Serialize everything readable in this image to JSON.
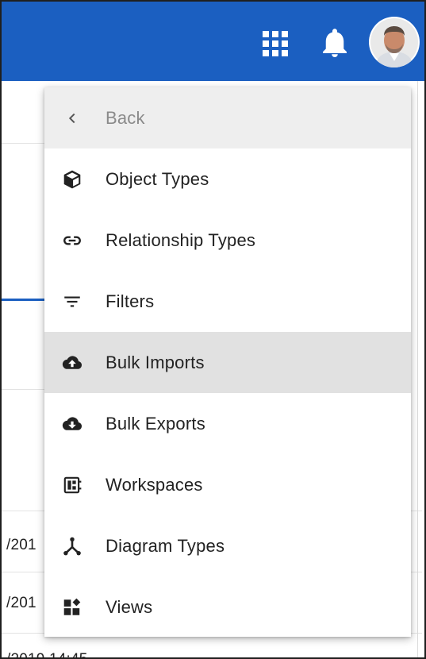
{
  "header": {
    "apps_icon": "apps-grid-icon",
    "notifications_icon": "bell-icon",
    "avatar_icon": "user-avatar",
    "accent_color": "#1b5fc1"
  },
  "background": {
    "rows": [
      "/201",
      "/201",
      "/2019 14:45"
    ]
  },
  "menu": {
    "back_label": "Back",
    "items": [
      {
        "label": "Object Types",
        "icon": "cube-icon"
      },
      {
        "label": "Relationship Types",
        "icon": "link-icon"
      },
      {
        "label": "Filters",
        "icon": "filter-icon"
      },
      {
        "label": "Bulk Imports",
        "icon": "cloud-upload-icon",
        "active": true
      },
      {
        "label": "Bulk Exports",
        "icon": "cloud-download-icon"
      },
      {
        "label": "Workspaces",
        "icon": "workspace-icon"
      },
      {
        "label": "Diagram Types",
        "icon": "hub-icon"
      },
      {
        "label": "Views",
        "icon": "views-icon"
      }
    ]
  }
}
